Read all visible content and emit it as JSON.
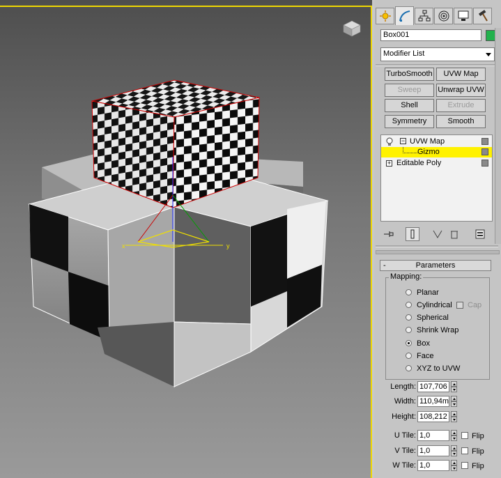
{
  "viewport": {
    "axis_x": "x",
    "axis_y": "y"
  },
  "command_panel": {
    "tabs": [
      {
        "icon": "create-icon"
      },
      {
        "icon": "modify-icon"
      },
      {
        "icon": "hierarchy-icon"
      },
      {
        "icon": "motion-icon"
      },
      {
        "icon": "display-icon"
      },
      {
        "icon": "utilities-icon"
      }
    ],
    "object_name": "Box001",
    "object_color": "#22b14c",
    "modifier_list": "Modifier List",
    "modifier_buttons": [
      {
        "label": "TurboSmooth",
        "enabled": true
      },
      {
        "label": "UVW Map",
        "enabled": true
      },
      {
        "label": "Sweep",
        "enabled": false
      },
      {
        "label": "Unwrap UVW",
        "enabled": true
      },
      {
        "label": "Shell",
        "enabled": true
      },
      {
        "label": "Extrude",
        "enabled": false
      },
      {
        "label": "Symmetry",
        "enabled": true
      },
      {
        "label": "Smooth",
        "enabled": true
      }
    ],
    "stack": [
      {
        "label": "UVW Map"
      },
      {
        "label": "Gizmo",
        "selected": true
      },
      {
        "label": "Editable Poly"
      }
    ],
    "rollout_title": "Parameters",
    "rollout_toggle": "-",
    "mapping": {
      "label": "Mapping:",
      "options": [
        {
          "label": "Planar",
          "checked": false
        },
        {
          "label": "Cylindrical",
          "checked": false
        },
        {
          "label": "Spherical",
          "checked": false
        },
        {
          "label": "Shrink Wrap",
          "checked": false
        },
        {
          "label": "Box",
          "checked": true
        },
        {
          "label": "Face",
          "checked": false
        },
        {
          "label": "XYZ to UVW",
          "checked": false
        }
      ],
      "cap_label": "Cap"
    },
    "dimensions": {
      "length_label": "Length:",
      "length": "107,706",
      "width_label": "Width:",
      "width": "110,94m",
      "height_label": "Height:",
      "height": "108,212"
    },
    "tiles": {
      "u_label": "U Tile:",
      "u": "1,0",
      "v_label": "V Tile:",
      "v": "1,0",
      "w_label": "W Tile:",
      "w": "1,0",
      "flip_label": "Flip"
    }
  }
}
